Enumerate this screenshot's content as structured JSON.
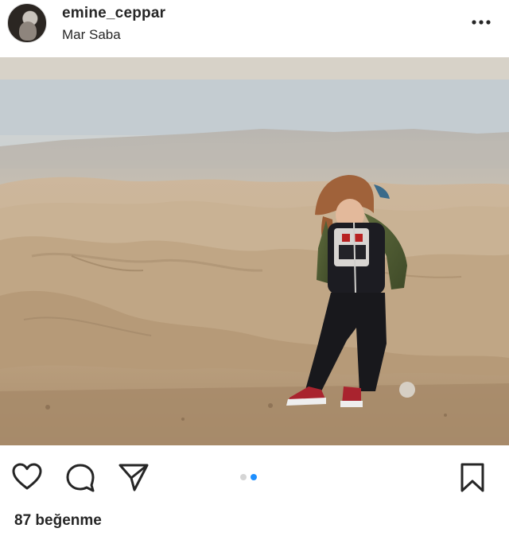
{
  "post": {
    "username": "emine_ceppar",
    "location": "Mar Saba",
    "likes_text": "87 beğenme",
    "carousel": {
      "count": 2,
      "active_index": 1
    }
  },
  "icons": {
    "more": "more-options-icon",
    "like": "heart-icon",
    "comment": "comment-bubble-icon",
    "share": "paper-plane-icon",
    "save": "bookmark-icon"
  },
  "colors": {
    "text": "#262626",
    "carousel_active": "#1e8fff",
    "carousel_inactive": "#d5d5d5"
  }
}
